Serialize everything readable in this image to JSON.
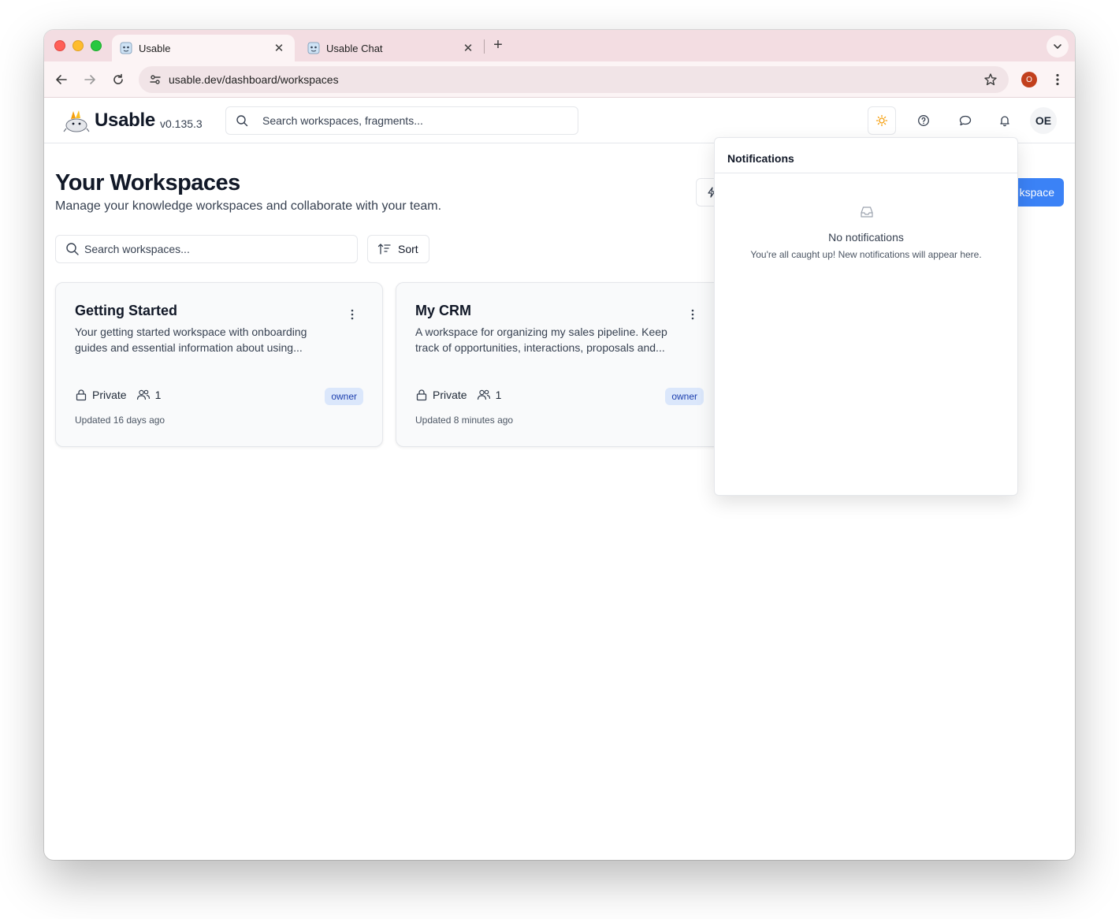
{
  "browser": {
    "tabs": [
      {
        "title": "Usable",
        "active": true
      },
      {
        "title": "Usable Chat",
        "active": false
      }
    ],
    "url": "usable.dev/dashboard/workspaces",
    "profile_initial": "O"
  },
  "header": {
    "brand": "Usable",
    "version": "v0.135.3",
    "search_placeholder": "Search workspaces, fragments...",
    "avatar_initials": "OE",
    "icons": [
      "sun-icon",
      "help-circle-icon",
      "chat-bubble-icon",
      "bell-icon"
    ]
  },
  "main": {
    "title": "Your Workspaces",
    "subtitle": "Manage your knowledge workspaces and collaborate with your team.",
    "new_workspace_label": "kspace",
    "search_placeholder": "Search workspaces...",
    "sort_label": "Sort"
  },
  "workspaces": [
    {
      "title": "Getting Started",
      "description": "Your getting started workspace with onboarding guides and essential information about using...",
      "visibility": "Private",
      "members": "1",
      "role": "owner",
      "updated": "Updated 16 days ago"
    },
    {
      "title": "My CRM",
      "description": "A workspace for organizing my sales pipeline. Keep track of opportunities, interactions, proposals and...",
      "visibility": "Private",
      "members": "1",
      "role": "owner",
      "updated": "Updated 8 minutes ago"
    }
  ],
  "notifications": {
    "title": "Notifications",
    "empty_title": "No notifications",
    "empty_text": "You're all caught up! New notifications will appear here."
  },
  "colors": {
    "accent": "#3b82f6",
    "tabstrip": "#f3dde2",
    "badge_bg": "#dbe7fb",
    "badge_text": "#1e40af",
    "theme_icon": "#f59e0b",
    "profile": "#c2401d"
  }
}
